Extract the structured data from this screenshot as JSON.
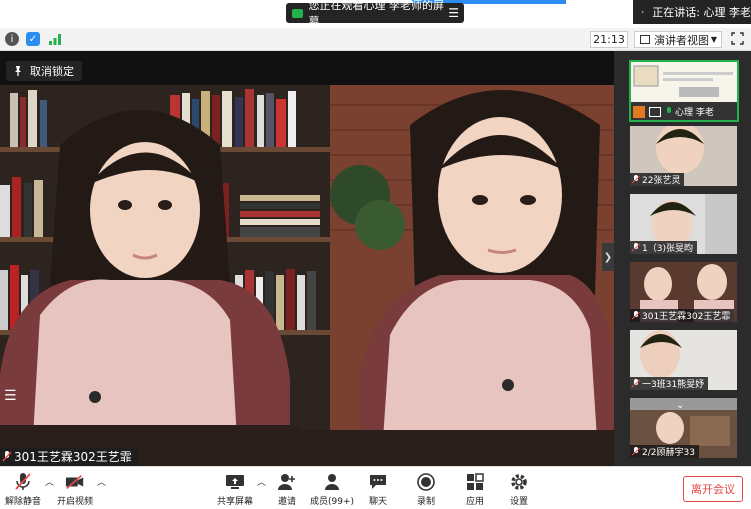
{
  "top": {
    "share_banner_text": "您正在观看心理  李老师的屏幕",
    "speaker_banner_text": "正在讲话: 心理  李老"
  },
  "infobar": {
    "clock": "21:13",
    "view_label": "演讲者视图"
  },
  "main": {
    "unlock_label": "取消锁定",
    "participant_name": "301王艺霖302王艺霏"
  },
  "sidebar": {
    "thumbs": [
      {
        "name": "心理  李老"
      },
      {
        "name": "22张艺灵"
      },
      {
        "name": "1（3)张旻昀"
      },
      {
        "name": "301王艺霖302王艺霏"
      },
      {
        "name": "一3班31熊旻妤"
      },
      {
        "name": "2/2顾赫宇33"
      }
    ]
  },
  "toolbar": {
    "unmute": "解除静音",
    "start_video": "开启视频",
    "share_screen": "共享屏幕",
    "invite": "邀请",
    "members": "成员(99+)",
    "chat": "聊天",
    "record": "录制",
    "apps": "应用",
    "settings": "设置",
    "leave": "离开会议"
  },
  "colors": {
    "accent_blue": "#2d8cf0",
    "green": "#22b14c",
    "leave_red": "#e54545",
    "mic_red": "#e84a4a"
  }
}
